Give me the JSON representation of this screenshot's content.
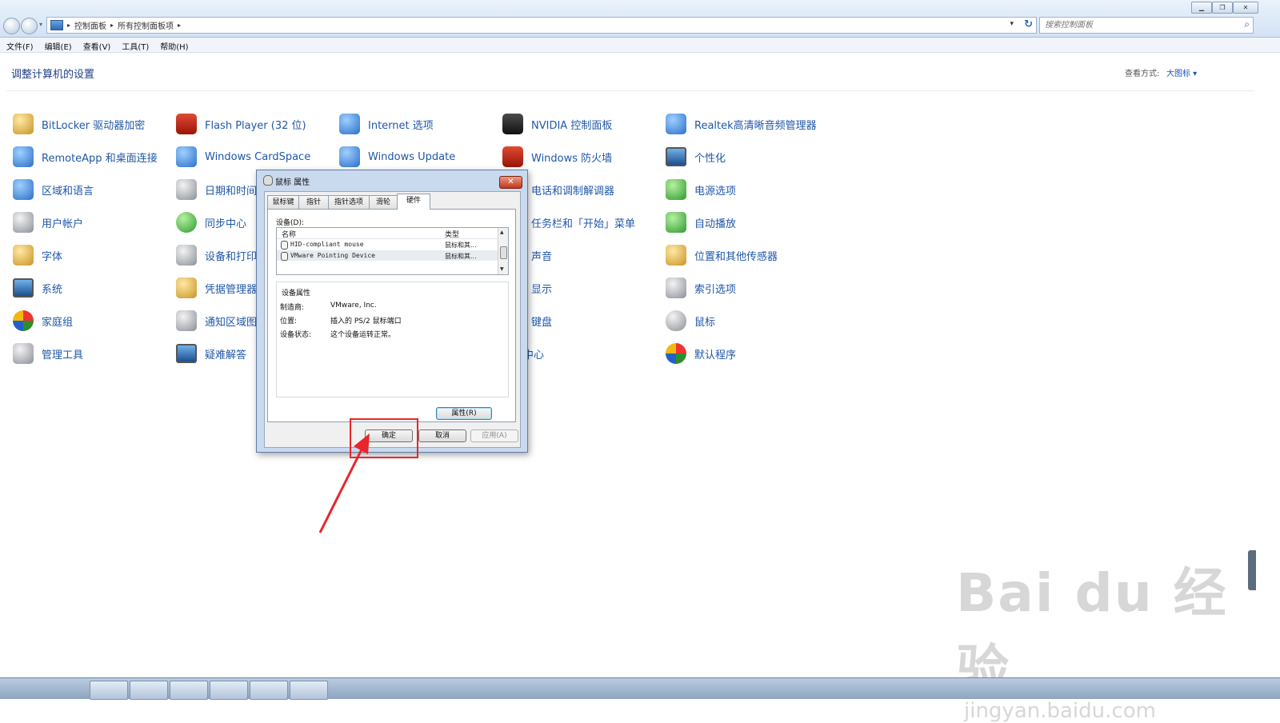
{
  "breadcrumbs": [
    "控制面板",
    "所有控制面板项"
  ],
  "search": {
    "placeholder": "搜索控制面板"
  },
  "menu": [
    "文件(F)",
    "编辑(E)",
    "查看(V)",
    "工具(T)",
    "帮助(H)"
  ],
  "page_title": "调整计算机的设置",
  "view": {
    "label": "查看方式:",
    "value": "大图标 ▾"
  },
  "items": [
    {
      "label": "BitLocker 驱动器加密",
      "icon": "bitlocker-icon"
    },
    {
      "label": "Flash Player (32 位)",
      "icon": "flash-icon"
    },
    {
      "label": "Internet 选项",
      "icon": "internet-icon"
    },
    {
      "label": "NVIDIA 控制面板",
      "icon": "nvidia-icon"
    },
    {
      "label": "Realtek高清晰音频管理器",
      "icon": "realtek-icon"
    },
    {
      "label": "RemoteApp 和桌面连接",
      "icon": "remoteapp-icon"
    },
    {
      "label": "Windows CardSpace",
      "icon": "cardspace-icon"
    },
    {
      "label": "Windows Update",
      "icon": "windows-update-icon"
    },
    {
      "label": "Windows 防火墙",
      "icon": "firewall-icon"
    },
    {
      "label": "个性化",
      "icon": "personalize-icon"
    },
    {
      "label": "区域和语言",
      "icon": "region-icon"
    },
    {
      "label": "日期和时间",
      "icon": "datetime-icon"
    },
    {
      "label": "电话和调制解调器",
      "icon": "phone-modem-icon"
    },
    {
      "label": "电源选项",
      "icon": "power-icon"
    },
    {
      "label": "用户帐户",
      "icon": "user-accounts-icon"
    },
    {
      "label": "同步中心",
      "icon": "sync-icon"
    },
    {
      "label": "任务栏和「开始」菜单",
      "icon": "taskbar-icon"
    },
    {
      "label": "自动播放",
      "icon": "autoplay-icon"
    },
    {
      "label": "字体",
      "icon": "fonts-icon"
    },
    {
      "label": "设备和打印",
      "icon": "devices-printers-icon"
    },
    {
      "label": "声音",
      "icon": "sound-icon"
    },
    {
      "label": "位置和其他传感器",
      "icon": "sensors-icon"
    },
    {
      "label": "系统",
      "icon": "system-icon"
    },
    {
      "label": "凭据管理器",
      "icon": "credential-icon"
    },
    {
      "label": "显示",
      "icon": "display-icon"
    },
    {
      "label": "索引选项",
      "icon": "indexing-icon"
    },
    {
      "label": "家庭组",
      "icon": "homegroup-icon"
    },
    {
      "label": "通知区域图",
      "icon": "notification-icon"
    },
    {
      "label": "键盘",
      "icon": "keyboard-icon"
    },
    {
      "label": "鼠标",
      "icon": "mouse-icon"
    },
    {
      "label": "管理工具",
      "icon": "admin-tools-icon"
    },
    {
      "label": "疑难解答",
      "icon": "troubleshoot-icon"
    },
    {
      "label": "操作中心",
      "icon": "action-center-icon"
    },
    {
      "label": "默认程序",
      "icon": "default-programs-icon"
    }
  ],
  "dialog": {
    "title": "鼠标 属性",
    "tabs": [
      "鼠标键",
      "指针",
      "指针选项",
      "滑轮",
      "硬件"
    ],
    "active_tab": "硬件",
    "devices_label": "设备(D):",
    "columns": {
      "name": "名称",
      "type": "类型"
    },
    "devices": [
      {
        "name": "HID-compliant mouse",
        "type": "鼠标和其..."
      },
      {
        "name": "VMware Pointing Device",
        "type": "鼠标和其..."
      }
    ],
    "properties_title": "设备属性",
    "properties": [
      {
        "key": "制造商:",
        "value": "VMware, Inc."
      },
      {
        "key": "位置:",
        "value": "插入的 PS/2 鼠标端口"
      },
      {
        "key": "设备状态:",
        "value": "这个设备运转正常。"
      }
    ],
    "properties_button": "属性(R)",
    "ok": "确定",
    "cancel": "取消",
    "apply": "应用(A)"
  },
  "watermark": {
    "logo": "Bai du 经验",
    "url": "jingyan.baidu.com"
  },
  "colors": {
    "link": "#1f57a8",
    "highlight": "#e8262b"
  }
}
